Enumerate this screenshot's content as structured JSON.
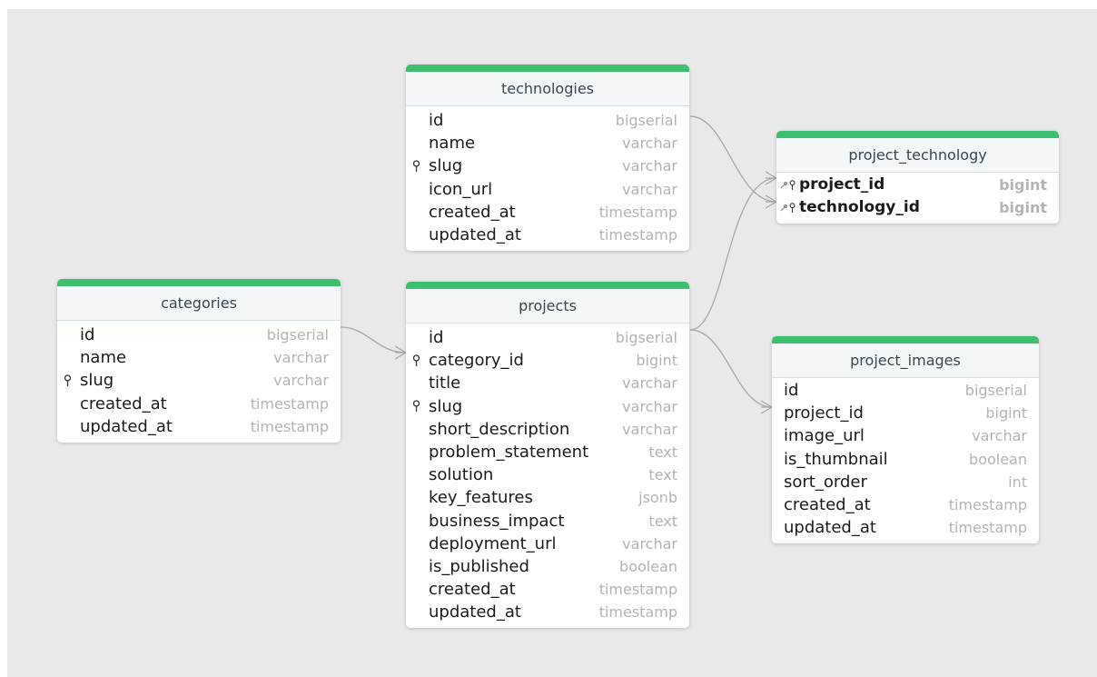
{
  "tables": {
    "technologies": {
      "name": "technologies",
      "columns": [
        {
          "name": "id",
          "type": "bigserial"
        },
        {
          "name": "name",
          "type": "varchar"
        },
        {
          "name": "slug",
          "type": "varchar"
        },
        {
          "name": "icon_url",
          "type": "varchar"
        },
        {
          "name": "created_at",
          "type": "timestamp"
        },
        {
          "name": "updated_at",
          "type": "timestamp"
        }
      ]
    },
    "categories": {
      "name": "categories",
      "columns": [
        {
          "name": "id",
          "type": "bigserial"
        },
        {
          "name": "name",
          "type": "varchar"
        },
        {
          "name": "slug",
          "type": "varchar"
        },
        {
          "name": "created_at",
          "type": "timestamp"
        },
        {
          "name": "updated_at",
          "type": "timestamp"
        }
      ]
    },
    "projects": {
      "name": "projects",
      "columns": [
        {
          "name": "id",
          "type": "bigserial"
        },
        {
          "name": "category_id",
          "type": "bigint"
        },
        {
          "name": "title",
          "type": "varchar"
        },
        {
          "name": "slug",
          "type": "varchar"
        },
        {
          "name": "short_description",
          "type": "varchar"
        },
        {
          "name": "problem_statement",
          "type": "text"
        },
        {
          "name": "solution",
          "type": "text"
        },
        {
          "name": "key_features",
          "type": "jsonb"
        },
        {
          "name": "business_impact",
          "type": "text"
        },
        {
          "name": "deployment_url",
          "type": "varchar"
        },
        {
          "name": "is_published",
          "type": "boolean"
        },
        {
          "name": "created_at",
          "type": "timestamp"
        },
        {
          "name": "updated_at",
          "type": "timestamp"
        }
      ]
    },
    "project_technology": {
      "name": "project_technology",
      "columns": [
        {
          "name": "project_id",
          "type": "bigint"
        },
        {
          "name": "technology_id",
          "type": "bigint"
        }
      ]
    },
    "project_images": {
      "name": "project_images",
      "columns": [
        {
          "name": "id",
          "type": "bigserial"
        },
        {
          "name": "project_id",
          "type": "bigint"
        },
        {
          "name": "image_url",
          "type": "varchar"
        },
        {
          "name": "is_thumbnail",
          "type": "boolean"
        },
        {
          "name": "sort_order",
          "type": "int"
        },
        {
          "name": "created_at",
          "type": "timestamp"
        },
        {
          "name": "updated_at",
          "type": "timestamp"
        }
      ]
    }
  },
  "colors": {
    "header_stripe": "#3cbf6e",
    "canvas_background": "#e9e9e9",
    "connector": "#a8a8a8",
    "type_text": "#b4b4b4"
  },
  "icons": {
    "key_icon": "key-icon",
    "foreign_key_icon": "link-icon"
  }
}
